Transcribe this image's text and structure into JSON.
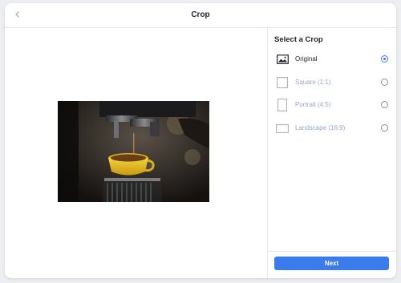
{
  "header": {
    "title": "Crop",
    "back_icon": "chevron-left-icon"
  },
  "preview": {
    "image_subject": "espresso machine pouring into yellow cup"
  },
  "panel": {
    "title": "Select a Crop",
    "options": [
      {
        "label": "Original",
        "icon": "image-icon",
        "selected": true
      },
      {
        "label": "Square (1:1)",
        "icon": "square-icon",
        "selected": false
      },
      {
        "label": "Portrait (4:5)",
        "icon": "portrait-icon",
        "selected": false
      },
      {
        "label": "Landscape (16:9)",
        "icon": "landscape-icon",
        "selected": false
      }
    ]
  },
  "footer": {
    "next_label": "Next"
  },
  "colors": {
    "accent": "#3a7cec",
    "disabled_text": "#9aa8c1",
    "background": "#eceef1"
  }
}
